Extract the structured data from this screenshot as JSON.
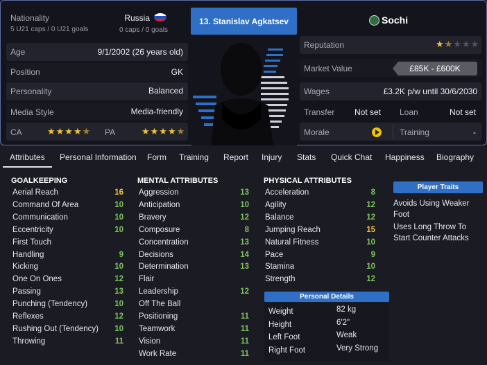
{
  "header": {
    "nationality_label": "Nationality",
    "nationality_value": "Russia",
    "u21_caps": "5 U21 caps / 0 U21 goals",
    "senior_caps": "0 caps / 0 goals",
    "player_name": "13. Stanislav Agkatsev",
    "club": "Sochi",
    "age_label": "Age",
    "age_value": "9/1/2002 (26 years old)",
    "position_label": "Position",
    "position_value": "GK",
    "personality_label": "Personality",
    "personality_value": "Balanced",
    "media_label": "Media Style",
    "media_value": "Media-friendly",
    "ca_label": "CA",
    "pa_label": "PA",
    "ca_stars": 4.5,
    "pa_stars": 4.5,
    "reputation_label": "Reputation",
    "reputation_stars": 1.5,
    "market_value_label": "Market Value",
    "market_value": "£85K - £600K",
    "wages_label": "Wages",
    "wages_value": "£3.2K p/w until 30/6/2030",
    "transfer_label": "Transfer",
    "transfer_value": "Not set",
    "loan_label": "Loan",
    "loan_value": "Not set",
    "morale_label": "Morale",
    "training_label": "Training",
    "training_value": "-"
  },
  "tabs": [
    "Attributes",
    "Personal Information",
    "Form",
    "Training",
    "Report",
    "Injury",
    "Stats",
    "Quick Chat",
    "Happiness",
    "Biography"
  ],
  "goalkeeping": {
    "title": "GOALKEEPING",
    "items": [
      {
        "name": "Aerial Reach",
        "value": "16",
        "color": "y"
      },
      {
        "name": "Command Of Area",
        "value": "10",
        "color": "g"
      },
      {
        "name": "Communication",
        "value": "10",
        "color": "g"
      },
      {
        "name": "Eccentricity",
        "value": "10",
        "color": "g"
      },
      {
        "name": "First Touch",
        "value": "",
        "color": "g"
      },
      {
        "name": "Handling",
        "value": "9",
        "color": "g"
      },
      {
        "name": "Kicking",
        "value": "10",
        "color": "g"
      },
      {
        "name": "One On Ones",
        "value": "12",
        "color": "g"
      },
      {
        "name": "Passing",
        "value": "13",
        "color": "g"
      },
      {
        "name": "Punching (Tendency)",
        "value": "10",
        "color": "g"
      },
      {
        "name": "Reflexes",
        "value": "12",
        "color": "g"
      },
      {
        "name": "Rushing Out (Tendency)",
        "value": "10",
        "color": "g"
      },
      {
        "name": "Throwing",
        "value": "11",
        "color": "g"
      }
    ]
  },
  "mental": {
    "title": "MENTAL ATTRIBUTES",
    "items": [
      {
        "name": "Aggression",
        "value": "13",
        "color": "g"
      },
      {
        "name": "Anticipation",
        "value": "10",
        "color": "g"
      },
      {
        "name": "Bravery",
        "value": "12",
        "color": "g"
      },
      {
        "name": "Composure",
        "value": "8",
        "color": "g"
      },
      {
        "name": "Concentration",
        "value": "13",
        "color": "g"
      },
      {
        "name": "Decisions",
        "value": "14",
        "color": "g"
      },
      {
        "name": "Determination",
        "value": "13",
        "color": "g"
      },
      {
        "name": "Flair",
        "value": "",
        "color": "g"
      },
      {
        "name": "Leadership",
        "value": "12",
        "color": "g"
      },
      {
        "name": "Off The Ball",
        "value": "",
        "color": "g"
      },
      {
        "name": "Positioning",
        "value": "11",
        "color": "g"
      },
      {
        "name": "Teamwork",
        "value": "11",
        "color": "g"
      },
      {
        "name": "Vision",
        "value": "11",
        "color": "g"
      },
      {
        "name": "Work Rate",
        "value": "11",
        "color": "g"
      }
    ]
  },
  "physical": {
    "title": "PHYSICAL ATTRIBUTES",
    "items": [
      {
        "name": "Acceleration",
        "value": "8",
        "color": "g"
      },
      {
        "name": "Agility",
        "value": "12",
        "color": "g"
      },
      {
        "name": "Balance",
        "value": "12",
        "color": "g"
      },
      {
        "name": "Jumping Reach",
        "value": "15",
        "color": "y"
      },
      {
        "name": "Natural Fitness",
        "value": "10",
        "color": "g"
      },
      {
        "name": "Pace",
        "value": "9",
        "color": "g"
      },
      {
        "name": "Stamina",
        "value": "10",
        "color": "g"
      },
      {
        "name": "Strength",
        "value": "12",
        "color": "g"
      }
    ]
  },
  "traits": {
    "title": "Player Traits",
    "items": [
      "Avoids Using Weaker Foot",
      "Uses Long Throw To Start Counter Attacks"
    ]
  },
  "personal": {
    "title": "Personal Details",
    "items": [
      {
        "label": "Weight",
        "value": "82 kg"
      },
      {
        "label": "Height",
        "value": "6'2\""
      },
      {
        "label": "Left Foot",
        "value": "Weak"
      },
      {
        "label": "Right Foot",
        "value": "Very Strong"
      }
    ]
  },
  "colors": {
    "accent": "#2f6fc6",
    "good": "#7cc55a",
    "high": "#f0c23c"
  }
}
